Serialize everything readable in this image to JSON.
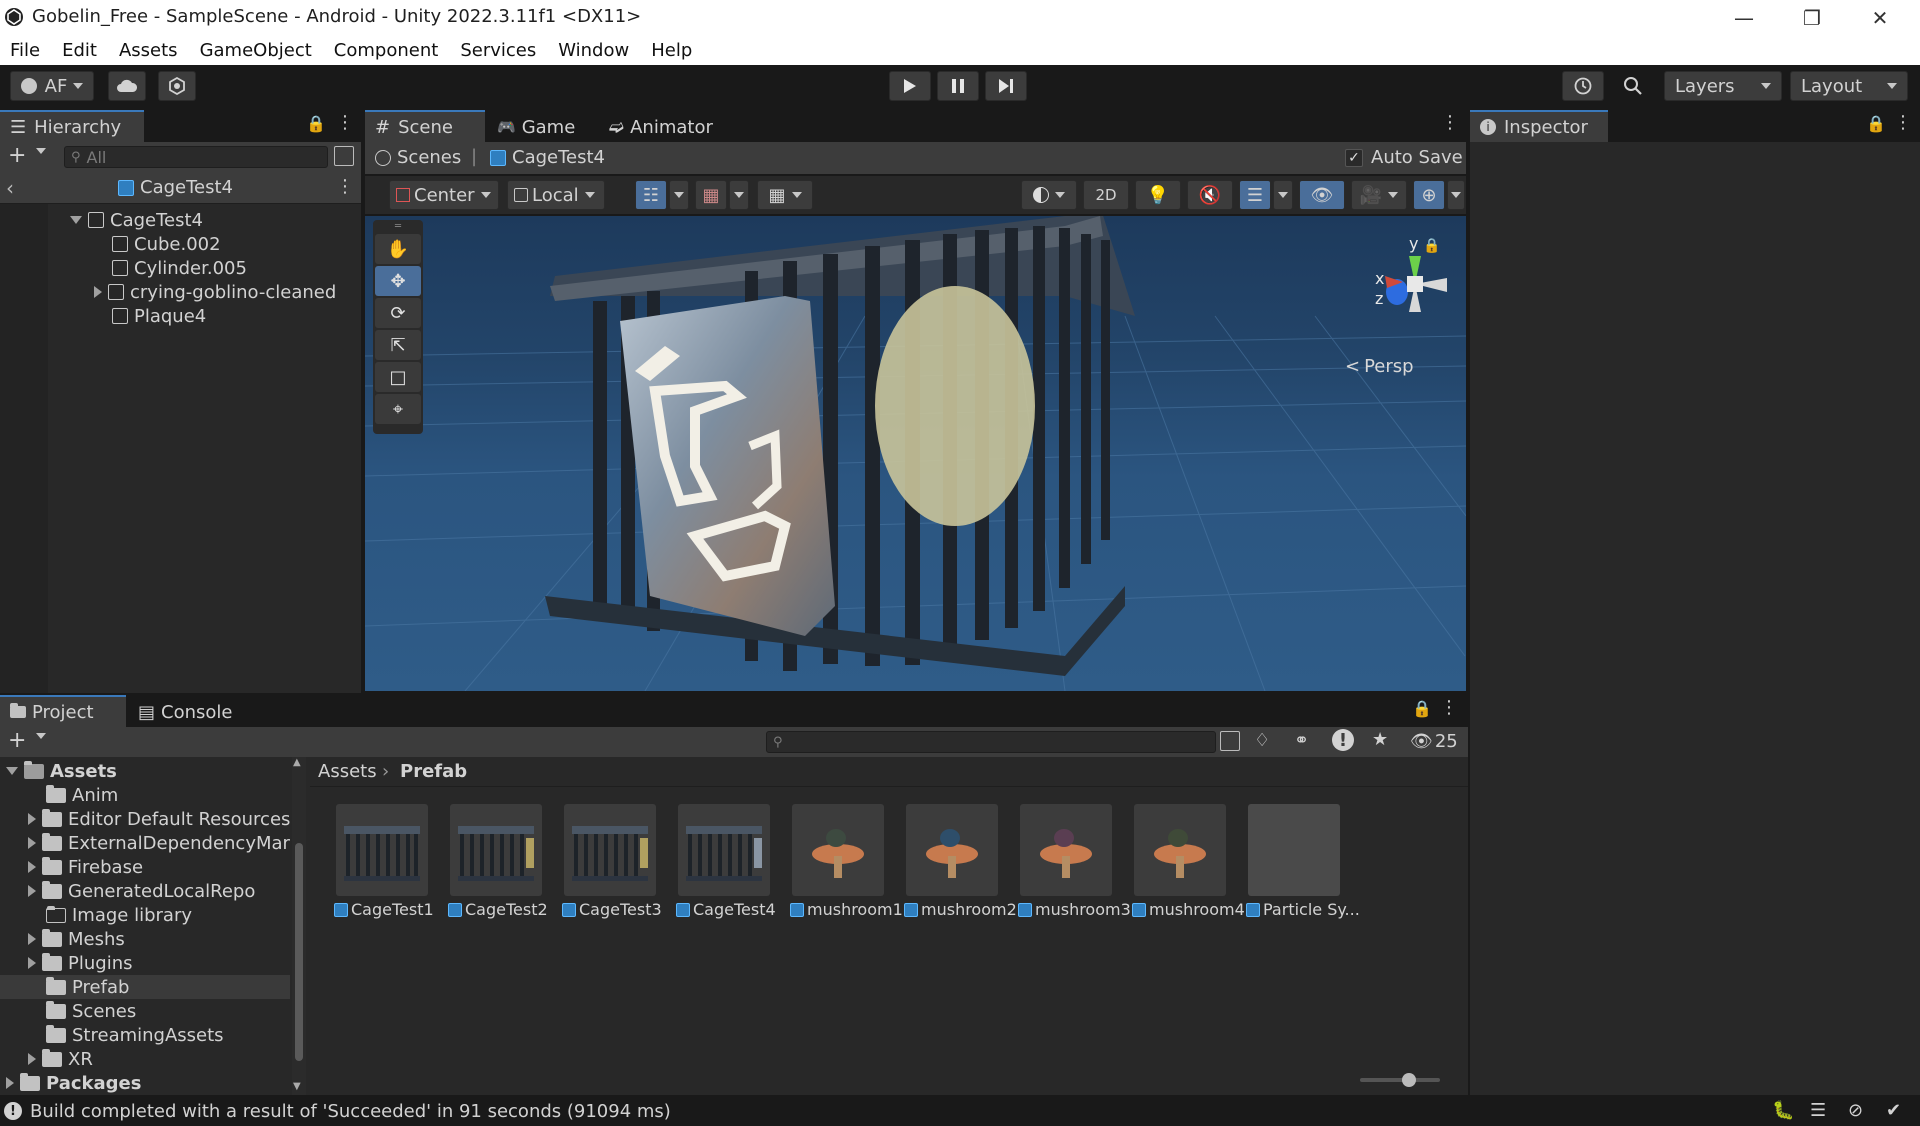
{
  "window": {
    "title": "Gobelin_Free - SampleScene - Android - Unity 2022.3.11f1 <DX11>"
  },
  "menu": [
    "File",
    "Edit",
    "Assets",
    "GameObject",
    "Component",
    "Services",
    "Window",
    "Help"
  ],
  "toolbar": {
    "account": "AF",
    "layers": "Layers",
    "layout": "Layout"
  },
  "hierarchy": {
    "tab": "Hierarchy",
    "search_placeholder": "All",
    "root": "CageTest4",
    "items": [
      {
        "label": "CageTest4",
        "depth": 0,
        "expandable": true,
        "expanded": true
      },
      {
        "label": "Cube.002",
        "depth": 1,
        "expandable": false
      },
      {
        "label": "Cylinder.005",
        "depth": 1,
        "expandable": false
      },
      {
        "label": "crying-goblino-cleaned",
        "depth": 1,
        "expandable": true,
        "expanded": false
      },
      {
        "label": "Plaque4",
        "depth": 1,
        "expandable": false
      }
    ]
  },
  "scene": {
    "tabs": [
      "Scene",
      "Game",
      "Animator"
    ],
    "breadcrumb": [
      "Scenes",
      "CageTest4"
    ],
    "auto_save": "Auto Save",
    "pivot": "Center",
    "space": "Local",
    "mode_2d": "2D",
    "persp": "Persp",
    "gizmo_axes": {
      "y": "y",
      "x": "x",
      "z": "z"
    }
  },
  "inspector": {
    "tab": "Inspector"
  },
  "project": {
    "tabs": [
      "Project",
      "Console"
    ],
    "hidden_count": "25",
    "breadcrumb": [
      "Assets",
      "Prefab"
    ],
    "tree": [
      {
        "label": "Assets",
        "depth": 0,
        "expandable": true,
        "expanded": true,
        "bold": true
      },
      {
        "label": "Anim",
        "depth": 1,
        "expandable": false
      },
      {
        "label": "Editor Default Resources",
        "depth": 1,
        "expandable": true
      },
      {
        "label": "ExternalDependencyMar",
        "depth": 1,
        "expandable": true
      },
      {
        "label": "Firebase",
        "depth": 1,
        "expandable": true
      },
      {
        "label": "GeneratedLocalRepo",
        "depth": 1,
        "expandable": true
      },
      {
        "label": "Image library",
        "depth": 1,
        "expandable": false,
        "empty": true
      },
      {
        "label": "Meshs",
        "depth": 1,
        "expandable": true
      },
      {
        "label": "Plugins",
        "depth": 1,
        "expandable": true
      },
      {
        "label": "Prefab",
        "depth": 1,
        "expandable": false,
        "selected": true
      },
      {
        "label": "Scenes",
        "depth": 1,
        "expandable": false
      },
      {
        "label": "StreamingAssets",
        "depth": 1,
        "expandable": false
      },
      {
        "label": "XR",
        "depth": 1,
        "expandable": true
      },
      {
        "label": "Packages",
        "depth": 0,
        "expandable": true,
        "bold": true
      }
    ],
    "assets": [
      {
        "label": "CageTest1",
        "kind": "cage"
      },
      {
        "label": "CageTest2",
        "kind": "cage"
      },
      {
        "label": "CageTest3",
        "kind": "cage"
      },
      {
        "label": "CageTest4",
        "kind": "cage"
      },
      {
        "label": "mushroom1",
        "kind": "mushroom"
      },
      {
        "label": "mushroom2",
        "kind": "mushroom"
      },
      {
        "label": "mushroom3",
        "kind": "mushroom"
      },
      {
        "label": "mushroom4",
        "kind": "mushroom"
      },
      {
        "label": "Particle Sy...",
        "kind": "empty"
      }
    ]
  },
  "status": {
    "message": "Build completed with a result of 'Succeeded' in 91 seconds (91094 ms)"
  },
  "colors": {
    "accent": "#3a79bb",
    "panel": "#282828",
    "dark": "#191919",
    "toolbar": "#3c3c3c"
  }
}
